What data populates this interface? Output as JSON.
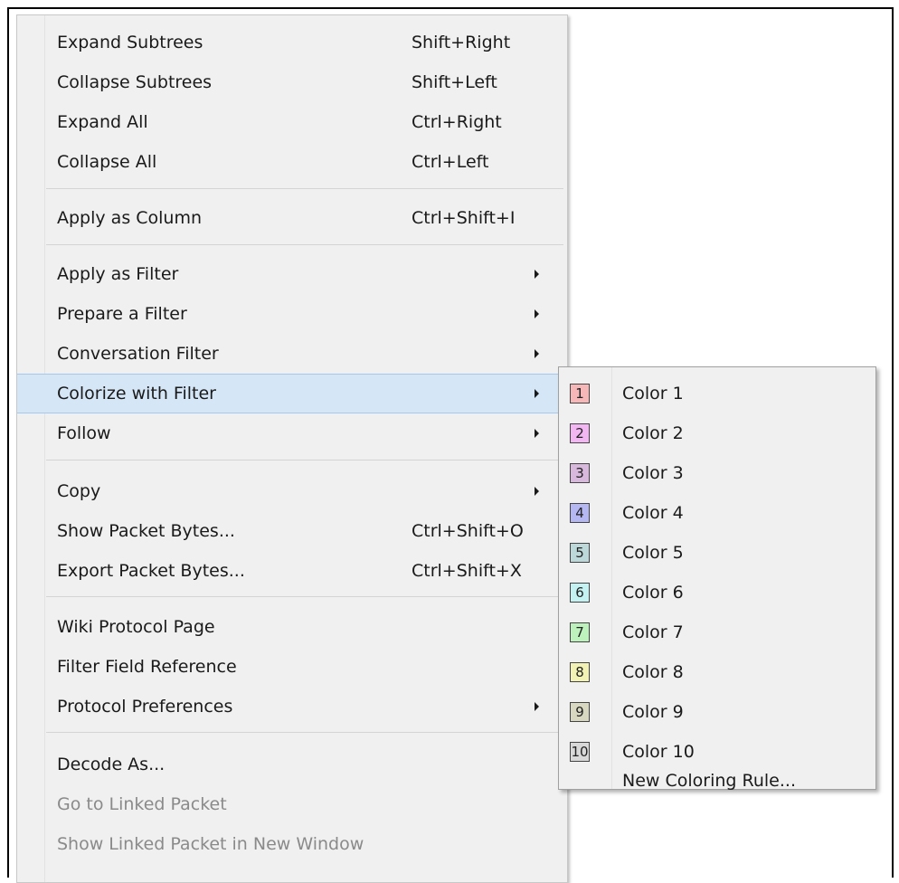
{
  "menu": {
    "items": [
      {
        "label": "Expand Subtrees",
        "shortcut": "Shift+Right"
      },
      {
        "label": "Collapse Subtrees",
        "shortcut": "Shift+Left"
      },
      {
        "label": "Expand All",
        "shortcut": "Ctrl+Right"
      },
      {
        "label": "Collapse All",
        "shortcut": "Ctrl+Left"
      },
      {
        "label": "Apply as Column",
        "shortcut": "Ctrl+Shift+I"
      },
      {
        "label": "Apply as Filter",
        "shortcut": ""
      },
      {
        "label": "Prepare a Filter",
        "shortcut": ""
      },
      {
        "label": "Conversation Filter",
        "shortcut": ""
      },
      {
        "label": "Colorize with Filter",
        "shortcut": ""
      },
      {
        "label": "Follow",
        "shortcut": ""
      },
      {
        "label": "Copy",
        "shortcut": ""
      },
      {
        "label": "Show Packet Bytes...",
        "shortcut": "Ctrl+Shift+O"
      },
      {
        "label": "Export Packet Bytes...",
        "shortcut": "Ctrl+Shift+X"
      },
      {
        "label": "Wiki Protocol Page",
        "shortcut": ""
      },
      {
        "label": "Filter Field Reference",
        "shortcut": ""
      },
      {
        "label": "Protocol Preferences",
        "shortcut": ""
      },
      {
        "label": "Decode As...",
        "shortcut": ""
      },
      {
        "label": "Go to Linked Packet",
        "shortcut": ""
      },
      {
        "label": "Show Linked Packet in New Window",
        "shortcut": ""
      }
    ]
  },
  "submenu": {
    "items": [
      {
        "number": "1",
        "label": "Color 1",
        "color": "#f5b7b7"
      },
      {
        "number": "2",
        "label": "Color 2",
        "color": "#f2b7f2"
      },
      {
        "number": "3",
        "label": "Color 3",
        "color": "#d8b8dc"
      },
      {
        "number": "4",
        "label": "Color 4",
        "color": "#b4b7f2"
      },
      {
        "number": "5",
        "label": "Color 5",
        "color": "#bcd8d8"
      },
      {
        "number": "6",
        "label": "Color 6",
        "color": "#c4f2f2"
      },
      {
        "number": "7",
        "label": "Color 7",
        "color": "#bdf2bd"
      },
      {
        "number": "8",
        "label": "Color 8",
        "color": "#f2f2b4"
      },
      {
        "number": "9",
        "label": "Color 9",
        "color": "#d8d8c0"
      },
      {
        "number": "10",
        "label": "Color 10",
        "color": "#d8d8d8"
      },
      {
        "number": "",
        "label": "New Coloring Rule...",
        "color": ""
      }
    ]
  },
  "colors": {
    "highlight": "#d5e6f7",
    "highlight_border": "#a6c7ee",
    "menu_bg": "#f0f0f0",
    "disabled_text": "#8a8a8a"
  }
}
